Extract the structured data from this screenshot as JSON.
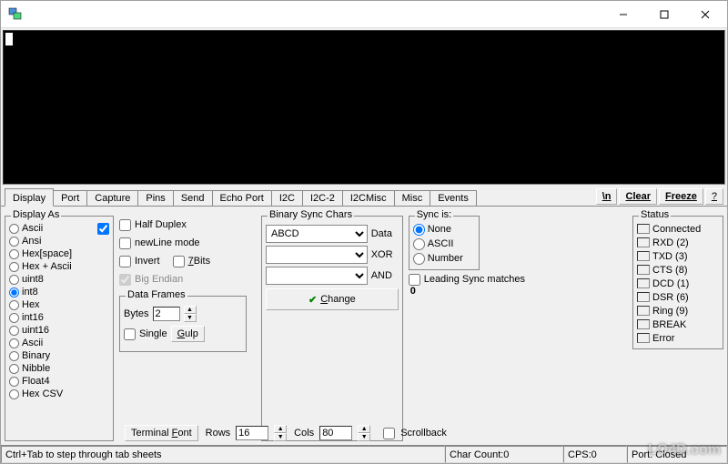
{
  "tabs": [
    "Display",
    "Port",
    "Capture",
    "Pins",
    "Send",
    "Echo Port",
    "I2C",
    "I2C-2",
    "I2CMisc",
    "Misc",
    "Events"
  ],
  "active_tab": 0,
  "side_buttons": {
    "newline": "\\n",
    "clear": "Clear",
    "freeze": "Freeze",
    "help": "?"
  },
  "display_as": {
    "legend": "Display As",
    "options": [
      "Ascii",
      "Ansi",
      "Hex[space]",
      "Hex + Ascii",
      "uint8",
      "int8",
      "Hex",
      "int16",
      "uint16",
      "Ascii",
      "Binary",
      "Nibble",
      "Float4",
      "Hex CSV"
    ],
    "selected": "int8",
    "first_checkbox": true
  },
  "mid_checks": {
    "half_duplex": "Half Duplex",
    "newline_mode": "newLine mode",
    "invert": "Invert",
    "seven_bits": "7Bits",
    "big_endian": "Big Endian"
  },
  "data_frames": {
    "legend": "Data Frames",
    "bytes_label": "Bytes",
    "bytes_value": "2",
    "single": "Single",
    "gulp": "Gulp"
  },
  "binary_sync": {
    "legend": "Binary Sync Chars",
    "row1_value": "ABCD",
    "labels": [
      "Data",
      "XOR",
      "AND"
    ],
    "change": "Change"
  },
  "sync_is": {
    "legend": "Sync is:",
    "options": [
      "None",
      "ASCII",
      "Number"
    ],
    "selected": "None",
    "leading": "Leading Sync matches",
    "leading_count": "0"
  },
  "bottom": {
    "terminal_font": "Terminal Font",
    "rows_lbl": "Rows",
    "rows_val": "16",
    "cols_lbl": "Cols",
    "cols_val": "80",
    "scrollback": "Scrollback"
  },
  "status_box": {
    "legend": "Status",
    "items": [
      "Connected",
      "RXD (2)",
      "TXD (3)",
      "CTS (8)",
      "DCD (1)",
      "DSR (6)",
      "Ring (9)",
      "BREAK",
      "Error"
    ]
  },
  "statusbar": {
    "hint": "Ctrl+Tab to step through tab sheets",
    "char_count": "Char Count:0",
    "cps": "CPS:0",
    "port": "Port: Closed"
  },
  "watermark": "LO4D.com"
}
